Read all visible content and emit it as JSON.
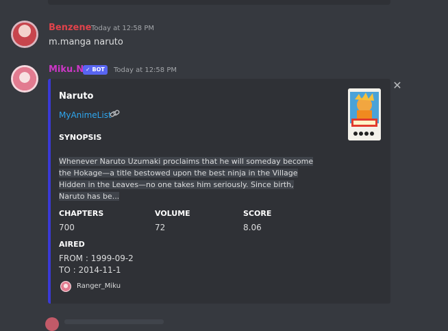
{
  "messages": [
    {
      "username": "Benzene",
      "timestamp": "Today at 12:58 PM",
      "content": "m.manga naruto",
      "username_color": "#e0434b"
    },
    {
      "username": "Miku.N",
      "bot_badge": "✓ BOT",
      "timestamp": "Today at 12:58 PM",
      "username_color": "#cc37c6"
    }
  ],
  "embed": {
    "title": "Naruto",
    "link_text": "MyAnimeList",
    "synopsis_heading": "SYNOPSIS",
    "synopsis": "Whenever Naruto Uzumaki proclaims that he will someday become the Hokage—a title bestowed upon the best ninja in the Village Hidden in the Leaves—no one takes him seriously. Since birth, Naruto has be...",
    "fields": [
      {
        "label": "CHAPTERS",
        "value": "700"
      },
      {
        "label": "VOLUME",
        "value": "72"
      },
      {
        "label": "SCORE",
        "value": "8.06"
      }
    ],
    "aired_label": "AIRED",
    "aired_from": "FROM : 1999-09-2",
    "aired_to": "TO : 2014-11-1",
    "footer": "Ranger_Miku",
    "accent_color": "#3a3ad6"
  },
  "icons": {
    "link": "link-icon",
    "close": "close-icon"
  }
}
